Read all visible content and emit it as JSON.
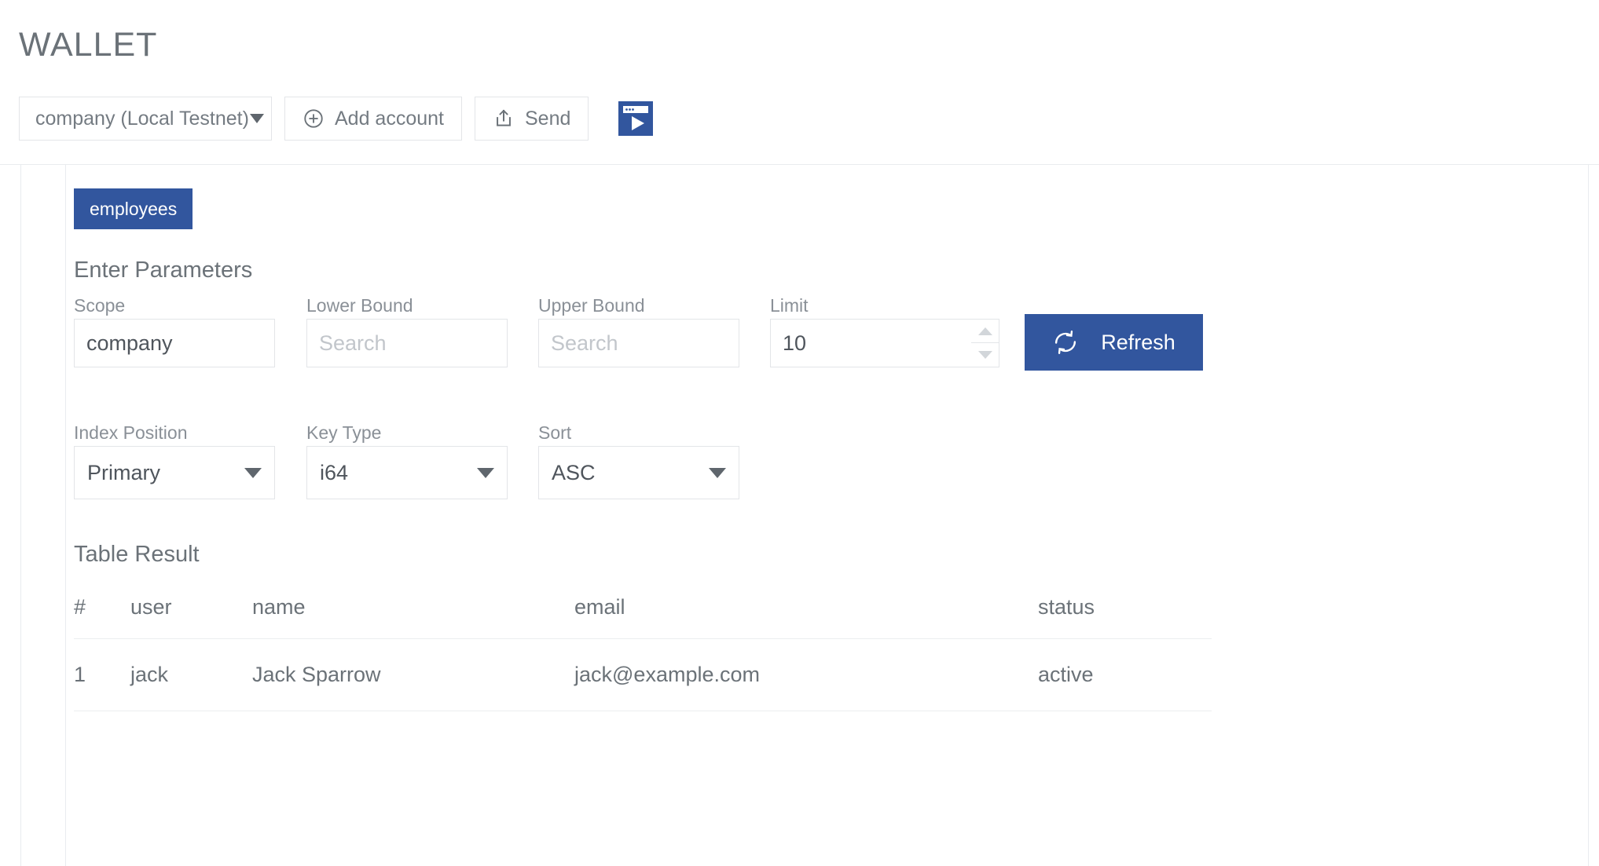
{
  "header": {
    "title": "WALLET",
    "account_select": {
      "value": "company (Local Testnet)",
      "caret_icon": "chevron-down-icon"
    },
    "add_account": {
      "label": "Add account",
      "icon": "plus-circle-icon"
    },
    "send": {
      "label": "Send",
      "icon": "upload-box-icon"
    },
    "browser_play": {
      "icon": "browser-play-icon",
      "color": "#32569e"
    }
  },
  "tabs": [
    {
      "label": "employees",
      "active": true
    }
  ],
  "parameters": {
    "heading": "Enter Parameters",
    "fields": [
      {
        "label": "Scope",
        "value": "company",
        "placeholder": ""
      },
      {
        "label": "Lower Bound",
        "value": "",
        "placeholder": "Search"
      },
      {
        "label": "Upper Bound",
        "value": "",
        "placeholder": "Search"
      },
      {
        "label": "Limit",
        "value": "10",
        "placeholder": ""
      }
    ],
    "refresh_button": {
      "label": "Refresh",
      "icon": "refresh-icon",
      "color": "#32569e"
    },
    "selects": [
      {
        "label": "Index Position",
        "value": "Primary"
      },
      {
        "label": "Key Type",
        "value": "i64"
      },
      {
        "label": "Sort",
        "value": "ASC"
      }
    ]
  },
  "table_result": {
    "heading": "Table Result",
    "columns": [
      "#",
      "user",
      "name",
      "email",
      "status"
    ],
    "rows": [
      {
        "index": "1",
        "user": "jack",
        "name": "Jack Sparrow",
        "email": "jack@example.com",
        "status": "active"
      }
    ]
  },
  "colors": {
    "accent": "#32569e",
    "text": "#6b7278",
    "muted": "#8a9097",
    "border": "#e3e5e8",
    "rail": "#e9ecef"
  }
}
